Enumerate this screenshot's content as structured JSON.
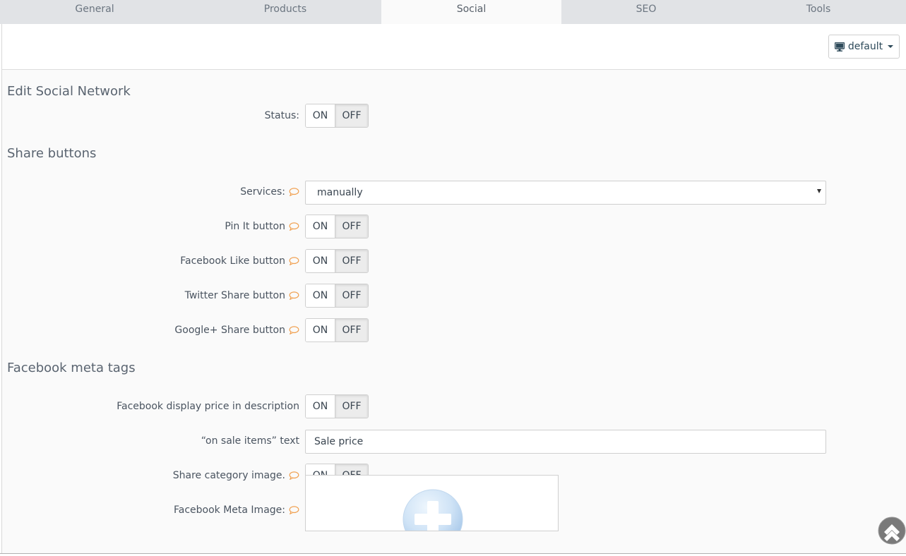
{
  "tabs": [
    {
      "label": "General"
    },
    {
      "label": "Products"
    },
    {
      "label": "Social",
      "active": true
    },
    {
      "label": "SEO"
    },
    {
      "label": "Tools"
    }
  ],
  "toolbar": {
    "device_label": "default",
    "device_icon": "monitor-icon"
  },
  "sections": {
    "edit_social": "Edit Social Network",
    "share_buttons": "Share buttons",
    "facebook_meta": "Facebook meta tags"
  },
  "fields": {
    "status": {
      "label": "Status:",
      "value": "OFF"
    },
    "services": {
      "label": "Services:",
      "value": "manually"
    },
    "pin_it": {
      "label": "Pin It button",
      "value": "OFF"
    },
    "facebook_like": {
      "label": "Facebook Like button",
      "value": "OFF"
    },
    "twitter_share": {
      "label": "Twitter Share button",
      "value": "OFF"
    },
    "google_share": {
      "label": "Google+ Share button",
      "value": "OFF"
    },
    "fb_display_price": {
      "label": "Facebook display price in description",
      "value": "OFF"
    },
    "on_sale_text": {
      "label": "“on sale items” text",
      "value": "Sale price"
    },
    "share_category_image": {
      "label": "Share category image.",
      "value": "OFF"
    },
    "fb_meta_image": {
      "label": "Facebook Meta Image:"
    }
  },
  "toggle": {
    "on_label": "ON",
    "off_label": "OFF"
  },
  "colors": {
    "help_bubble": "#f0a050",
    "tab_bar": "#e1e3e6",
    "active_tab": "#fafafa",
    "scroll_top_button": "#7a7a7a"
  }
}
